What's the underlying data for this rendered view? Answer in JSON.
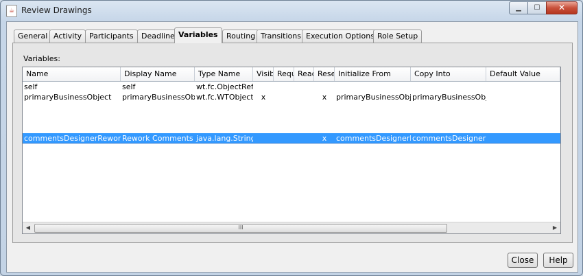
{
  "window": {
    "title": "Review Drawings",
    "icon": "java-cup-icon"
  },
  "tabs": [
    {
      "label": "General"
    },
    {
      "label": "Activity"
    },
    {
      "label": "Participants"
    },
    {
      "label": "Deadline"
    },
    {
      "label": "Variables"
    },
    {
      "label": "Routing"
    },
    {
      "label": "Transitions"
    },
    {
      "label": "Execution Options"
    },
    {
      "label": "Role Setup"
    }
  ],
  "active_tab": "Variables",
  "section_label": "Variables:",
  "table": {
    "columns": [
      "Name",
      "Display Name",
      "Type Name",
      "Visib",
      "Requ",
      "Read",
      "Rese",
      "Initialize From",
      "Copy Into",
      "Default Value"
    ],
    "rows": [
      [
        "self",
        "self",
        "wt.fc.ObjectRefe",
        "",
        "",
        "",
        "",
        "",
        "",
        ""
      ],
      [
        "primaryBusinessObject",
        "primaryBusinessObje",
        "wt.fc.WTObject",
        "x",
        "",
        "",
        "x",
        "primaryBusinessObje",
        "primaryBusinessObje",
        ""
      ],
      [
        "",
        "",
        "",
        "",
        "",
        "",
        "",
        "",
        "",
        ""
      ],
      [
        "",
        "",
        "",
        "",
        "",
        "",
        "",
        "",
        "",
        ""
      ],
      [
        "",
        "",
        "",
        "",
        "",
        "",
        "",
        "",
        "",
        ""
      ],
      [
        "commentsDesignerRework",
        "Rework Comments",
        "java.lang.String",
        "",
        "",
        "",
        "x",
        "commentsDesignerRe",
        "commentsDesignerRe",
        ""
      ],
      [
        "",
        "",
        "",
        "",
        "",
        "",
        "",
        "",
        "",
        ""
      ],
      [
        "",
        "",
        "",
        "",
        "",
        "",
        "",
        "",
        "",
        ""
      ],
      [
        "",
        "",
        "",
        "",
        "",
        "",
        "",
        "",
        "",
        ""
      ],
      [
        "",
        "",
        "",
        "",
        "",
        "",
        "",
        "",
        "",
        ""
      ]
    ],
    "selected_row": 5,
    "scrollbar_thumb_grip": "III"
  },
  "buttons": {
    "close": "Close",
    "help": "Help"
  },
  "colors": {
    "selection": "#3399ff",
    "close_button": "#c9513c"
  }
}
